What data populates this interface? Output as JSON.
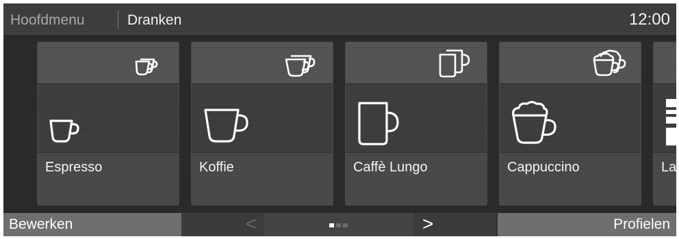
{
  "header": {
    "breadcrumb_root": "Hoofdmenu",
    "breadcrumb_current": "Dranken",
    "clock": "12:00"
  },
  "drinks": [
    {
      "label": "Espresso",
      "icon": "espresso-cup-icon"
    },
    {
      "label": "Koffie",
      "icon": "coffee-cup-icon"
    },
    {
      "label": "Caffè Lungo",
      "icon": "lungo-mug-icon"
    },
    {
      "label": "Cappuccino",
      "icon": "cappuccino-cup-icon"
    },
    {
      "label": "La",
      "icon": "latte-glass-icon"
    }
  ],
  "footer": {
    "edit_label": "Bewerken",
    "prev_label": "<",
    "next_label": ">",
    "profiles_label": "Profielen",
    "page_indicator": {
      "current": 1,
      "total": 3
    }
  },
  "colors": {
    "background": "#272727",
    "button": "#6c6c6c",
    "text": "#ffffff",
    "active_dot": "#ffffff",
    "inactive_dot": "#6a6a6a"
  }
}
